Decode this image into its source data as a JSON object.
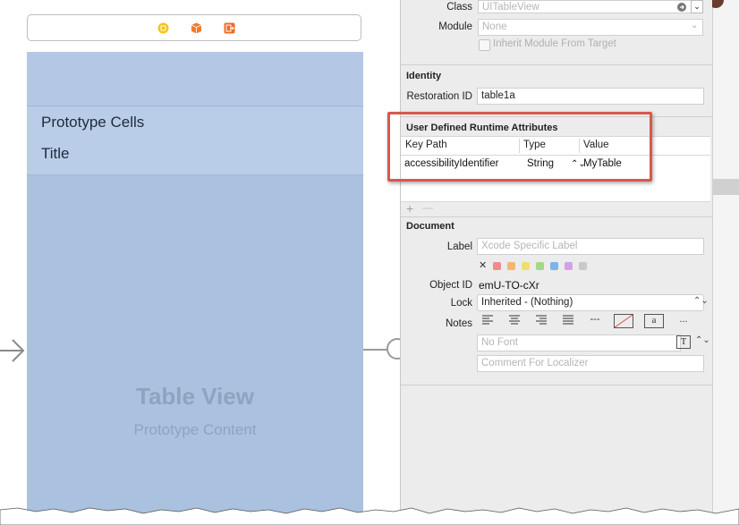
{
  "canvas": {
    "table_view": {
      "section_header": "Prototype Cells",
      "cell_title": "Title",
      "placeholder_title": "Table View",
      "placeholder_subtitle": "Prototype Content"
    },
    "scene_bar_icons": [
      "view-controller-icon",
      "first-responder-icon",
      "exit-icon"
    ]
  },
  "inspector": {
    "custom_class": {
      "class_label": "Class",
      "class_placeholder": "UITableView",
      "module_label": "Module",
      "module_placeholder": "None",
      "inherit_label": "Inherit Module From Target"
    },
    "identity": {
      "title": "Identity",
      "restoration_id_label": "Restoration ID",
      "restoration_id_value": "table1a"
    },
    "udra": {
      "title": "User Defined Runtime Attributes",
      "columns": [
        "Key Path",
        "Type",
        "Value"
      ],
      "rows": [
        {
          "key_path": "accessibilityIdentifier",
          "type": "String",
          "value": "MyTable"
        }
      ],
      "add_symbol": "+",
      "remove_symbol": "—"
    },
    "document": {
      "title": "Document",
      "label_label": "Label",
      "label_placeholder": "Xcode Specific Label",
      "clear_symbol": "✕",
      "label_colors": [
        "#f08c8c",
        "#f3b775",
        "#f0df6e",
        "#a5d98a",
        "#7fb3ea",
        "#d3a2e6",
        "#c9c9c9"
      ],
      "object_id_label": "Object ID",
      "object_id_value": "emU-TO-cXr",
      "lock_label": "Lock",
      "lock_value": "Inherited - (Nothing)",
      "notes_label": "Notes",
      "note_buttons": [
        "align-left-icon",
        "align-center-icon",
        "align-right-icon",
        "align-justify-icon",
        "---",
        "strike-icon",
        "a",
        "..."
      ],
      "font_placeholder": "No Font",
      "comment_placeholder": "Comment For Localizer"
    }
  },
  "colors": {
    "highlight": "#d9574e",
    "table_view_bg": "#aac1e0",
    "inspector_bg": "#ececec"
  }
}
